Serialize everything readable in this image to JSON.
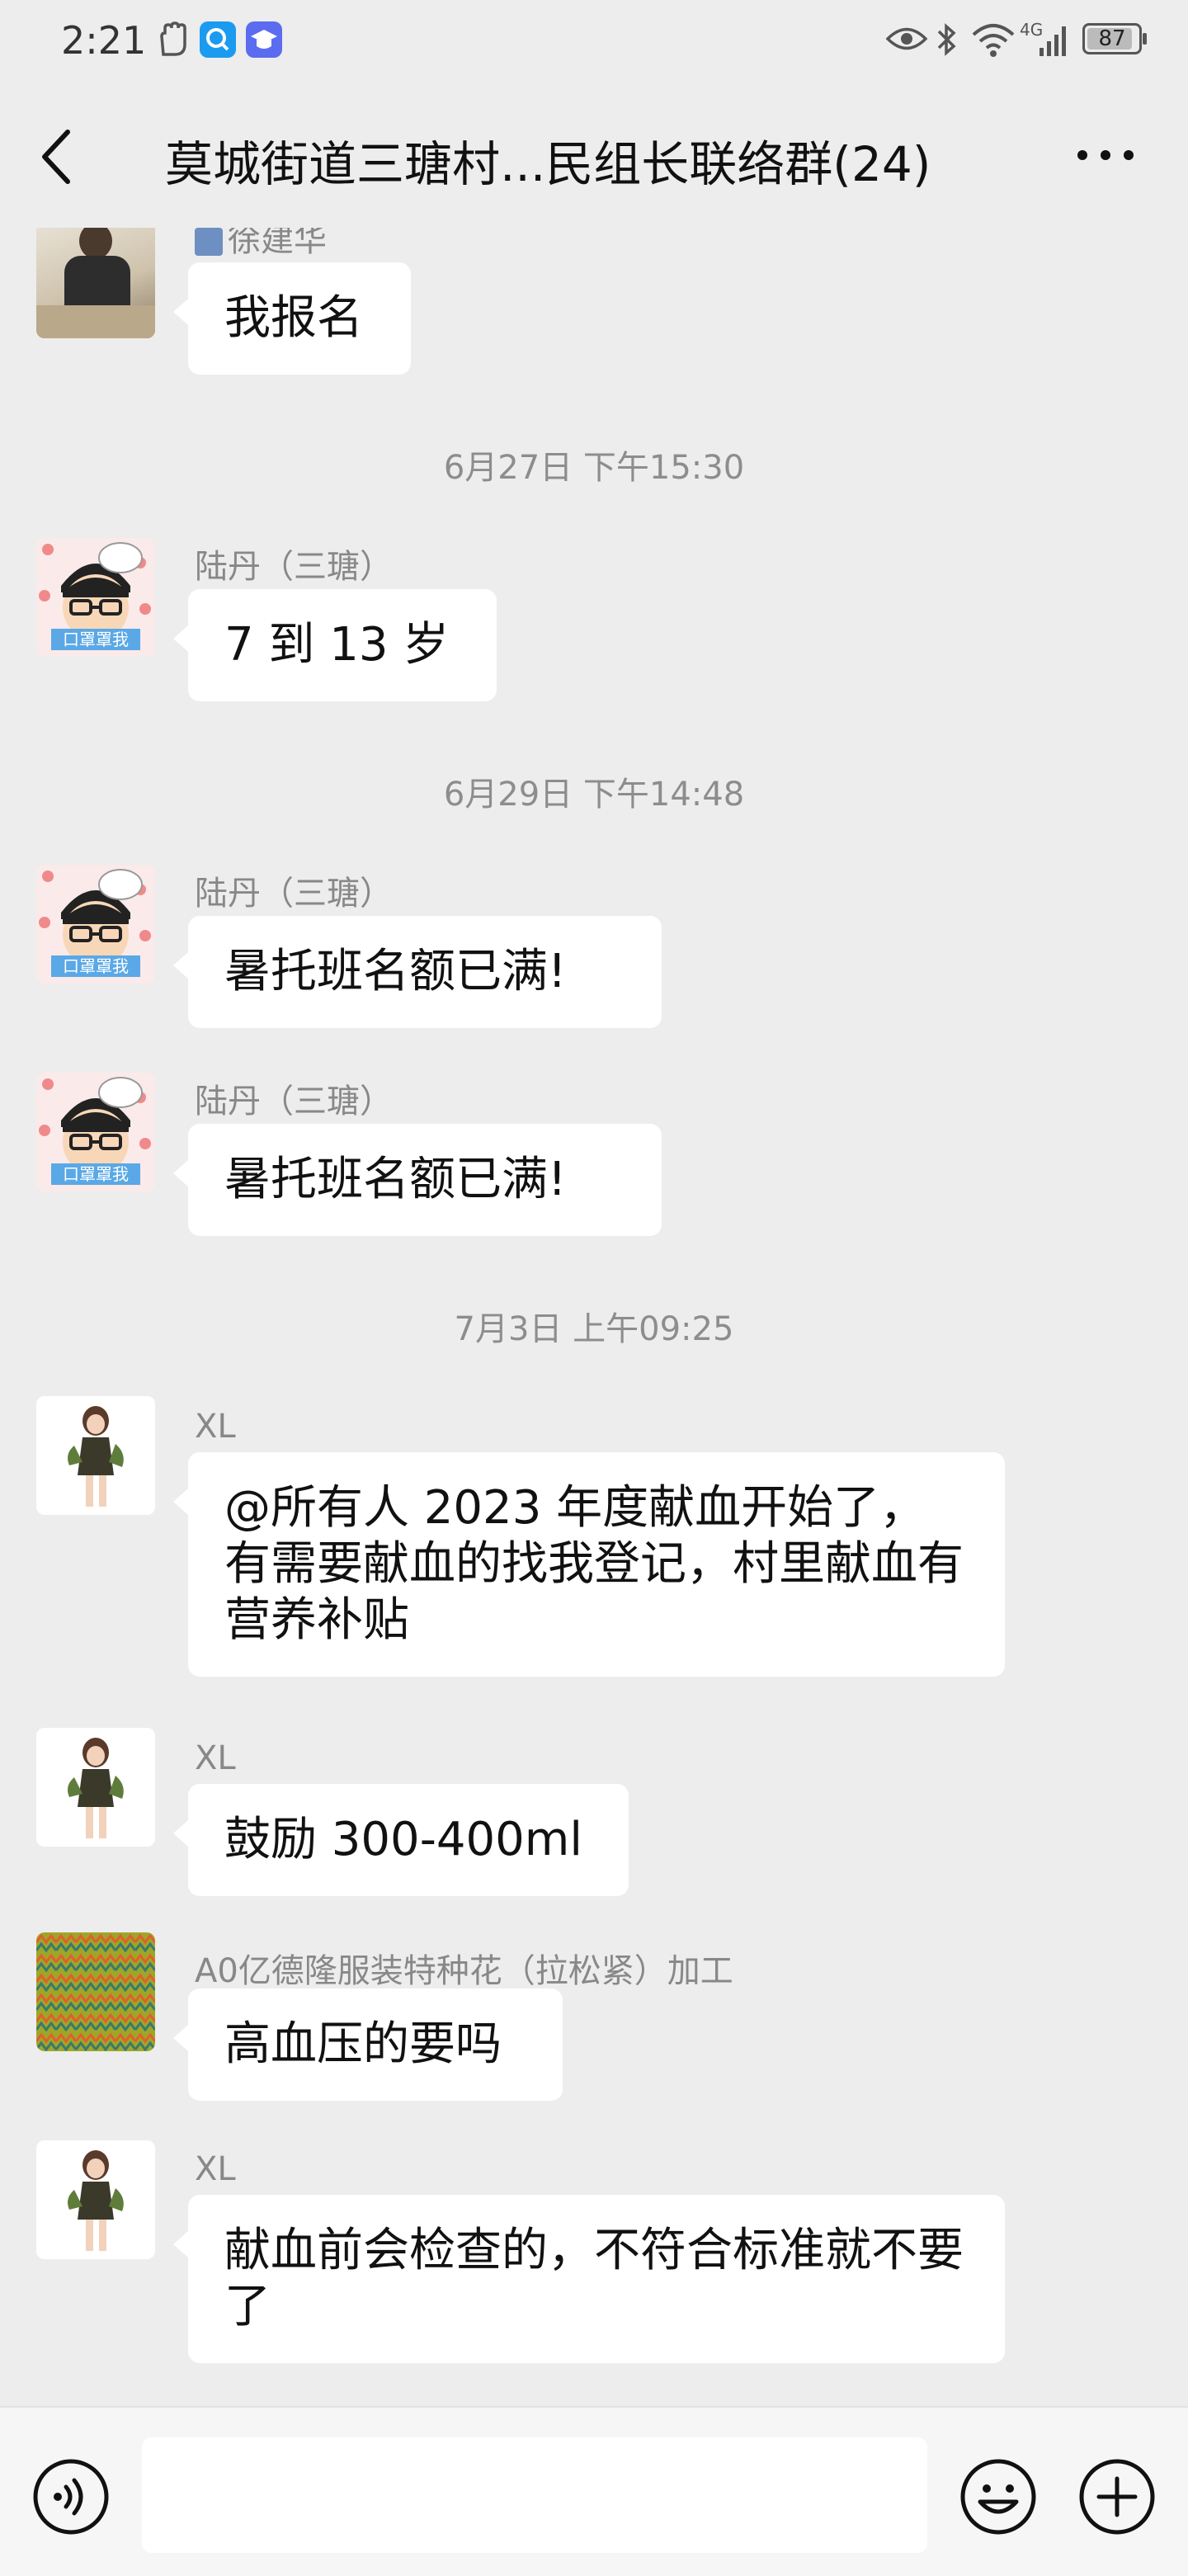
{
  "status_bar": {
    "time": "2:21",
    "network": "4G",
    "battery": "87",
    "icons": [
      "hand-icon",
      "search-app-icon",
      "cap-app-icon",
      "eye-icon",
      "bluetooth-icon",
      "wifi-icon",
      "signal-icon",
      "battery-icon"
    ]
  },
  "header": {
    "title": "莫城街道三瑭村...民组长联络群(24)"
  },
  "messages": [
    {
      "sender": "徐建华",
      "text": "我报名"
    },
    {
      "time": "6月27日 下午15:30"
    },
    {
      "sender": "陆丹（三瑭）",
      "text": "7 到 13 岁"
    },
    {
      "time": "6月29日 下午14:48"
    },
    {
      "sender": "陆丹（三瑭）",
      "text": "暑托班名额已满!"
    },
    {
      "sender": "陆丹（三瑭）",
      "text": "暑托班名额已满!"
    },
    {
      "time": "7月3日 上午09:25"
    },
    {
      "sender": "XL",
      "text": "@所有人  2023 年度献血开始了，有需要献血的找我登记，村里献血有营养补贴"
    },
    {
      "sender": "XL",
      "text": "鼓励 300-400ml"
    },
    {
      "sender": "A0亿德隆服装特种花（拉松紧）加工",
      "text": "高血压的要吗"
    },
    {
      "sender": "XL",
      "text": "献血前会检查的，不符合标准就不要了"
    }
  ],
  "avatar_labels": {
    "lu_dan": "口罩罩我"
  },
  "input": {
    "value": ""
  },
  "colors": {
    "background": "#ededed",
    "bubble": "#ffffff",
    "meta_text": "#8d8d8d"
  }
}
